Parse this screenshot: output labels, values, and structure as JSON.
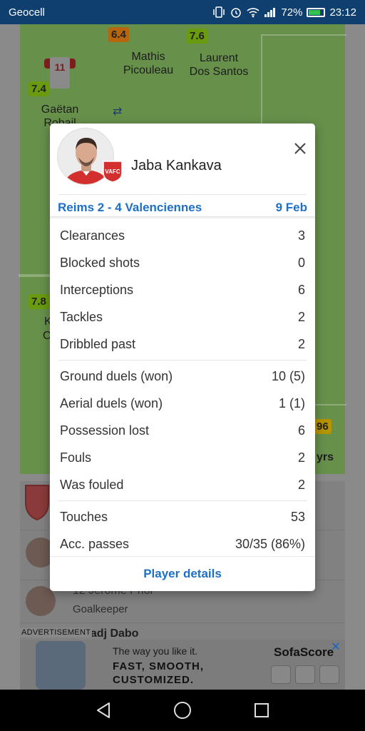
{
  "status_bar": {
    "carrier": "Geocell",
    "battery": "72%",
    "time": "23:12"
  },
  "background": {
    "ratings": [
      "6.4",
      "7.6",
      "7.4",
      "7.8",
      "96"
    ],
    "players": [
      {
        "first": "Mathis",
        "last": "Picouleau"
      },
      {
        "first": "Laurent",
        "last": "Dos Santos"
      },
      {
        "first": "Gaëtan",
        "last": "Robail"
      }
    ],
    "shirt_number": "11",
    "partial_texts": [
      "K",
      "C",
      "yrs"
    ],
    "list": [
      {
        "name": "12 Jérôme Prior",
        "role": "Goalkeeper"
      },
      {
        "name": "Elhadj Dabo",
        "role": ""
      }
    ]
  },
  "ad": {
    "label": "ADVERTISEMENT",
    "tagline": "The way you like it.",
    "headline_1": "FAST, SMOOTH,",
    "headline_2": "CUSTOMIZED.",
    "brand": "SofaScore"
  },
  "dialog": {
    "player_name": "Jaba Kankava",
    "club_badge_text": "VAFC",
    "match": "Reims 2 - 4 Valenciennes",
    "date": "9 Feb",
    "stat_groups": [
      [
        {
          "label": "Clearances",
          "value": "3"
        },
        {
          "label": "Blocked shots",
          "value": "0"
        },
        {
          "label": "Interceptions",
          "value": "6"
        },
        {
          "label": "Tackles",
          "value": "2"
        },
        {
          "label": "Dribbled past",
          "value": "2"
        }
      ],
      [
        {
          "label": "Ground duels (won)",
          "value": "10 (5)"
        },
        {
          "label": "Aerial duels (won)",
          "value": "1 (1)"
        },
        {
          "label": "Possession lost",
          "value": "6"
        },
        {
          "label": "Fouls",
          "value": "2"
        },
        {
          "label": "Was fouled",
          "value": "2"
        }
      ],
      [
        {
          "label": "Touches",
          "value": "53"
        },
        {
          "label": "Acc. passes",
          "value": "30/35 (86%)"
        }
      ]
    ],
    "footer_button": "Player details"
  },
  "colors": {
    "accent": "#1e6fc6",
    "status_bar": "#0e3f6e",
    "club_red": "#d32f2f"
  }
}
